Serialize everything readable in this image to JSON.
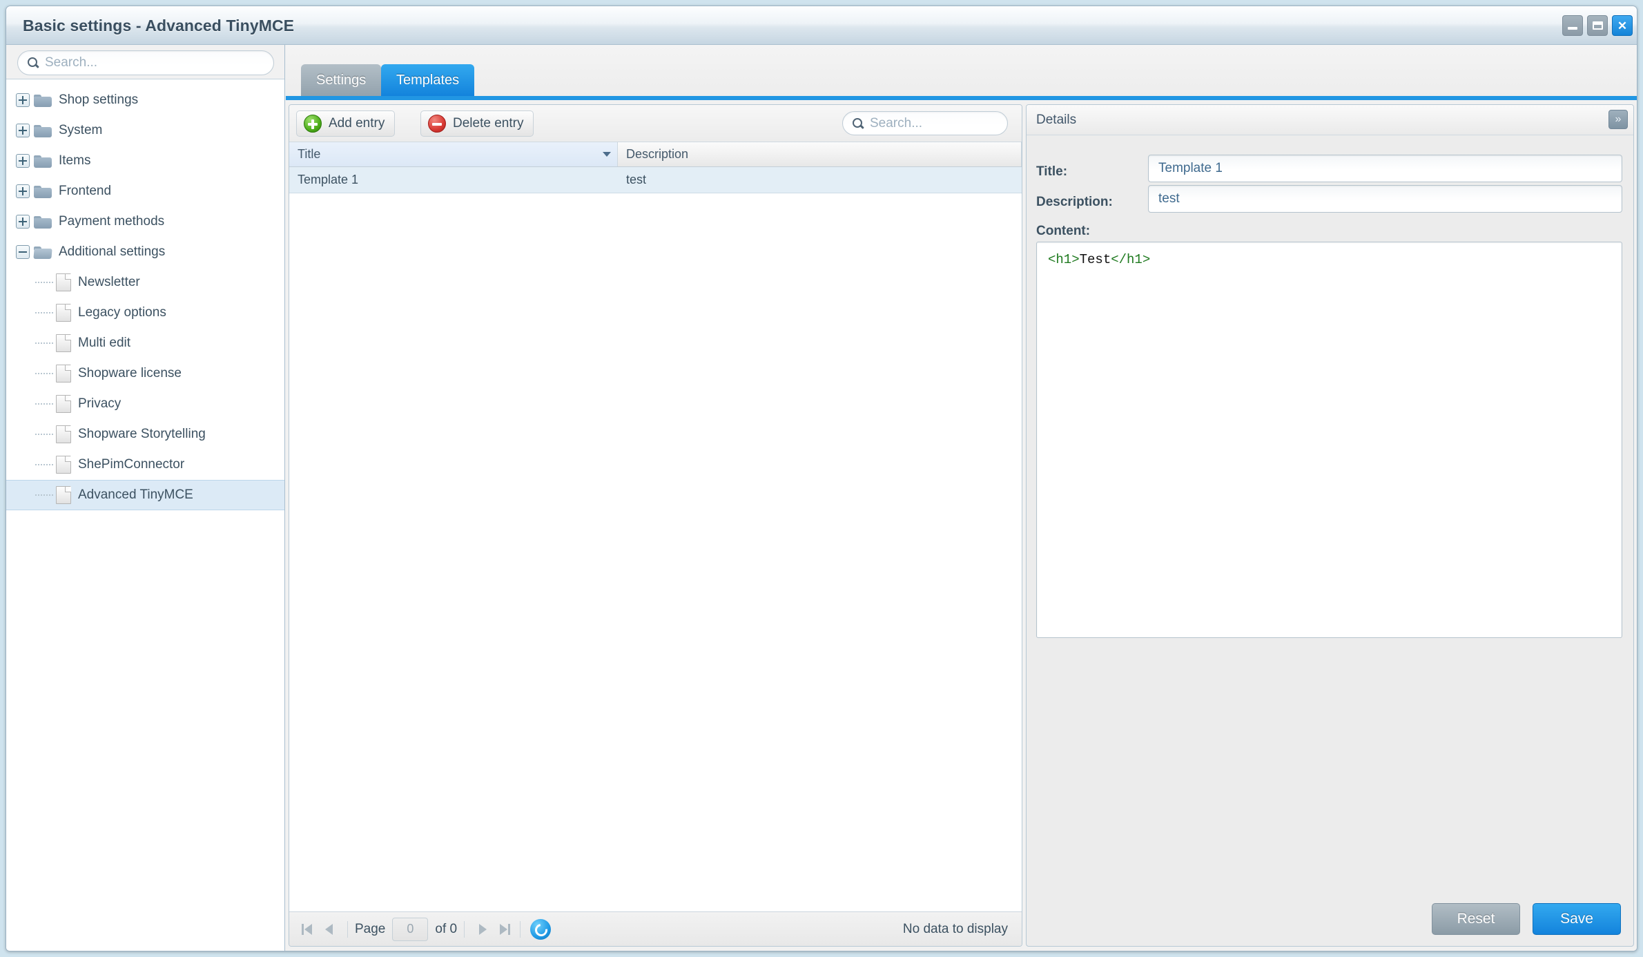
{
  "window": {
    "title": "Basic settings - Advanced TinyMCE",
    "controls": {
      "minimize": "minimize",
      "maximize": "maximize",
      "close": "close"
    }
  },
  "sidebar": {
    "search": {
      "placeholder": "Search...",
      "value": ""
    },
    "tree": [
      {
        "label": "Shop settings",
        "type": "folder",
        "state": "collapsed",
        "depth": 0,
        "selected": false
      },
      {
        "label": "System",
        "type": "folder",
        "state": "collapsed",
        "depth": 0,
        "selected": false
      },
      {
        "label": "Items",
        "type": "folder",
        "state": "collapsed",
        "depth": 0,
        "selected": false
      },
      {
        "label": "Frontend",
        "type": "folder",
        "state": "collapsed",
        "depth": 0,
        "selected": false
      },
      {
        "label": "Payment methods",
        "type": "folder",
        "state": "collapsed",
        "depth": 0,
        "selected": false
      },
      {
        "label": "Additional settings",
        "type": "folder",
        "state": "expanded",
        "depth": 0,
        "selected": false
      },
      {
        "label": "Newsletter",
        "type": "page",
        "state": "leaf",
        "depth": 1,
        "selected": false
      },
      {
        "label": "Legacy options",
        "type": "page",
        "state": "leaf",
        "depth": 1,
        "selected": false
      },
      {
        "label": "Multi edit",
        "type": "page",
        "state": "leaf",
        "depth": 1,
        "selected": false
      },
      {
        "label": "Shopware license",
        "type": "page",
        "state": "leaf",
        "depth": 1,
        "selected": false
      },
      {
        "label": "Privacy",
        "type": "page",
        "state": "leaf",
        "depth": 1,
        "selected": false
      },
      {
        "label": "Shopware Storytelling",
        "type": "page",
        "state": "leaf",
        "depth": 1,
        "selected": false
      },
      {
        "label": "ShePimConnector",
        "type": "page",
        "state": "leaf",
        "depth": 1,
        "selected": false
      },
      {
        "label": "Advanced TinyMCE",
        "type": "page",
        "state": "leaf",
        "depth": 1,
        "selected": true
      }
    ]
  },
  "tabs": [
    {
      "label": "Settings",
      "active": false
    },
    {
      "label": "Templates",
      "active": true
    }
  ],
  "grid": {
    "toolbar": {
      "add_label": "Add entry",
      "delete_label": "Delete entry",
      "search_placeholder": "Search...",
      "search_value": ""
    },
    "columns": [
      {
        "label": "Title",
        "sorted": true
      },
      {
        "label": "Description",
        "sorted": false
      }
    ],
    "rows": [
      {
        "title": "Template 1",
        "description": "test"
      }
    ],
    "footer": {
      "page_label": "Page",
      "page_value": "0",
      "of_label": "of 0",
      "status": "No data to display",
      "refresh": "refresh-icon"
    }
  },
  "details": {
    "header_title": "Details",
    "collapse_glyph": "»",
    "fields": {
      "title_label": "Title:",
      "title_value": "Template 1",
      "description_label": "Description:",
      "description_value": "test",
      "content_label": "Content:"
    },
    "content": {
      "open_tag": "<h1>",
      "text": "Test",
      "close_tag": "</h1>"
    },
    "buttons": {
      "reset_label": "Reset",
      "save_label": "Save"
    }
  },
  "colors": {
    "accent_blue": "#1383dc",
    "tab_active": "#2196e3",
    "selection": "#dceaf6",
    "row_selected": "#e3eef6",
    "code_tag_green": "#1f7a1f",
    "add_icon_green": "#4fae1b",
    "delete_icon_red": "#d83a34"
  }
}
